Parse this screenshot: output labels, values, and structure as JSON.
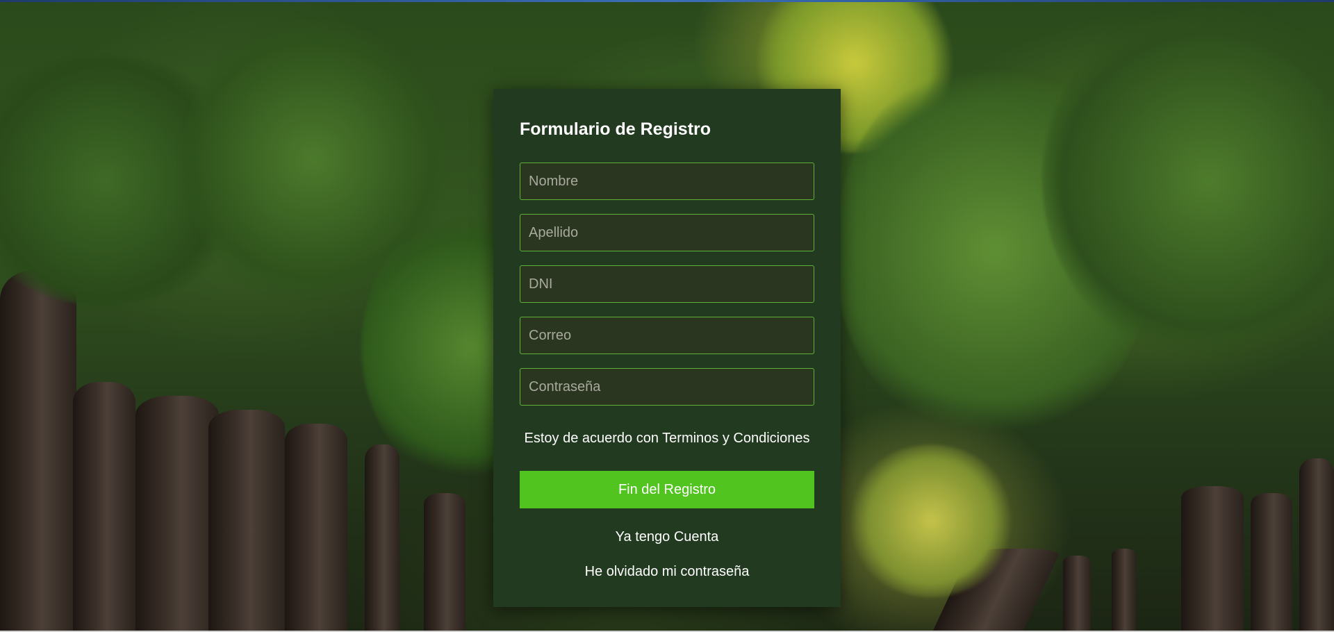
{
  "form": {
    "title": "Formulario de Registro",
    "fields": [
      {
        "name": "nombre",
        "placeholder": "Nombre",
        "value": ""
      },
      {
        "name": "apellido",
        "placeholder": "Apellido",
        "value": ""
      },
      {
        "name": "dni",
        "placeholder": "DNI",
        "value": ""
      },
      {
        "name": "correo",
        "placeholder": "Correo",
        "value": ""
      },
      {
        "name": "contrasena",
        "placeholder": "Contraseña",
        "value": ""
      }
    ],
    "terms_label": "Estoy de acuerdo con Terminos y Condiciones",
    "submit_label": "Fin del Registro",
    "have_account_link": "Ya tengo Cuenta",
    "forgot_password_link": "He olvidado mi contraseña"
  },
  "colors": {
    "card_background": "#223a20",
    "field_border": "#5fb236",
    "submit_button": "#52c41f"
  }
}
